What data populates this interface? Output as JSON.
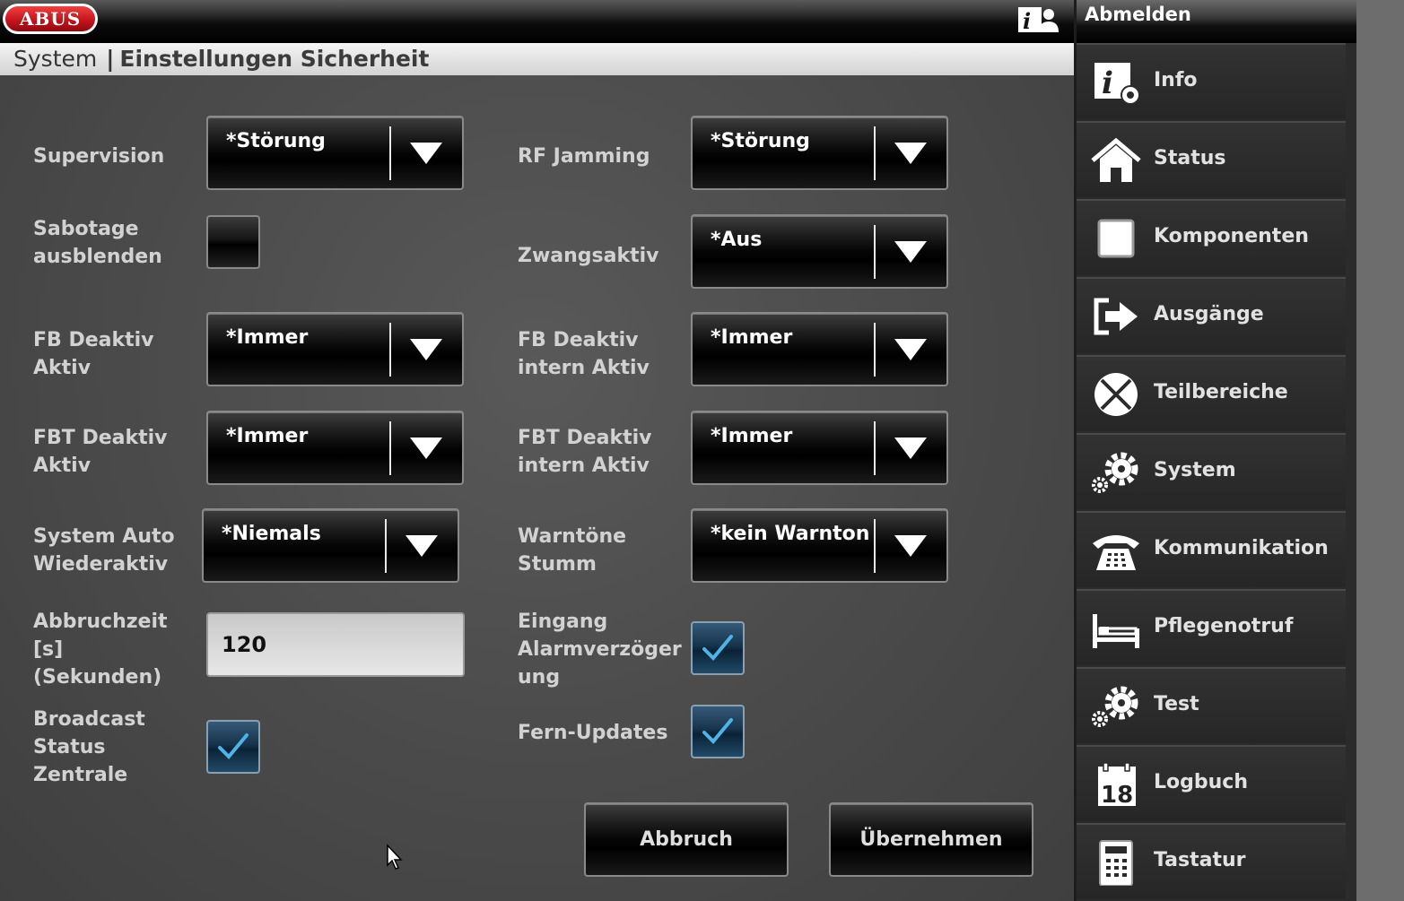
{
  "brand": {
    "logo_text": "ABUS"
  },
  "breadcrumb": {
    "section": "System",
    "separator": "|",
    "page": "Einstellungen Sicherheit"
  },
  "colors": {
    "accent_check": "#4fb2e8",
    "title_bg": "#e6e6e6",
    "background": "#4a4a4a"
  },
  "icons": {
    "help": "info-user-icon"
  },
  "form": {
    "supervision": {
      "label": "Supervision",
      "value": "*Störung"
    },
    "rf_jamming": {
      "label": "RF Jamming",
      "value": "*Störung"
    },
    "sabotage": {
      "label_1": "Sabotage",
      "label_2": "ausblenden",
      "checked": false
    },
    "zwangsaktiv": {
      "label": "Zwangsaktiv",
      "value": "*Aus"
    },
    "fb_deaktiv_aktiv": {
      "label_1": "FB Deaktiv",
      "label_2": "Aktiv",
      "value": "*Immer"
    },
    "fb_deaktiv_intern": {
      "label_1": "FB Deaktiv",
      "label_2": "intern Aktiv",
      "value": "*Immer"
    },
    "fbt_deaktiv_aktiv": {
      "label_1": "FBT Deaktiv",
      "label_2": "Aktiv",
      "value": "*Immer"
    },
    "fbt_deaktiv_intern": {
      "label_1": "FBT Deaktiv",
      "label_2": "intern Aktiv",
      "value": "*Immer"
    },
    "system_auto": {
      "label_1": "System Auto",
      "label_2": "Wiederaktiv",
      "value": "*Niemals"
    },
    "warntoene": {
      "label_1": "Warntöne",
      "label_2": "Stumm",
      "value": "*kein Warnton"
    },
    "abbruchzeit": {
      "label_1": "Abbruchzeit",
      "label_2": "[s]",
      "label_3": "(Sekunden)",
      "value": "120"
    },
    "eingang": {
      "label_1": "Eingang",
      "label_2": "Alarmverzöger",
      "label_3": "ung",
      "checked": true
    },
    "broadcast": {
      "label_1": "Broadcast",
      "label_2": "Status",
      "label_3": "Zentrale",
      "checked": true
    },
    "fern_updates": {
      "label": "Fern-Updates",
      "checked": true
    }
  },
  "actions": {
    "cancel": "Abbruch",
    "apply": "Übernehmen"
  },
  "sidebar": {
    "logout": "Abmelden",
    "items": [
      {
        "label": "Info",
        "icon": "info-gear-icon"
      },
      {
        "label": "Status",
        "icon": "house-icon"
      },
      {
        "label": "Komponenten",
        "icon": "square-icon"
      },
      {
        "label": "Ausgänge",
        "icon": "exit-arrow-icon"
      },
      {
        "label": "Teilbereiche",
        "icon": "pie-x-icon"
      },
      {
        "label": "System",
        "icon": "gears-icon"
      },
      {
        "label": "Kommunikation",
        "icon": "telephone-icon"
      },
      {
        "label": "Pflegenotruf",
        "icon": "bed-icon"
      },
      {
        "label": "Test",
        "icon": "gears-icon"
      },
      {
        "label": "Logbuch",
        "icon": "calendar-icon"
      },
      {
        "label": "Tastatur",
        "icon": "keypad-icon"
      }
    ],
    "calendar_day": "18"
  }
}
